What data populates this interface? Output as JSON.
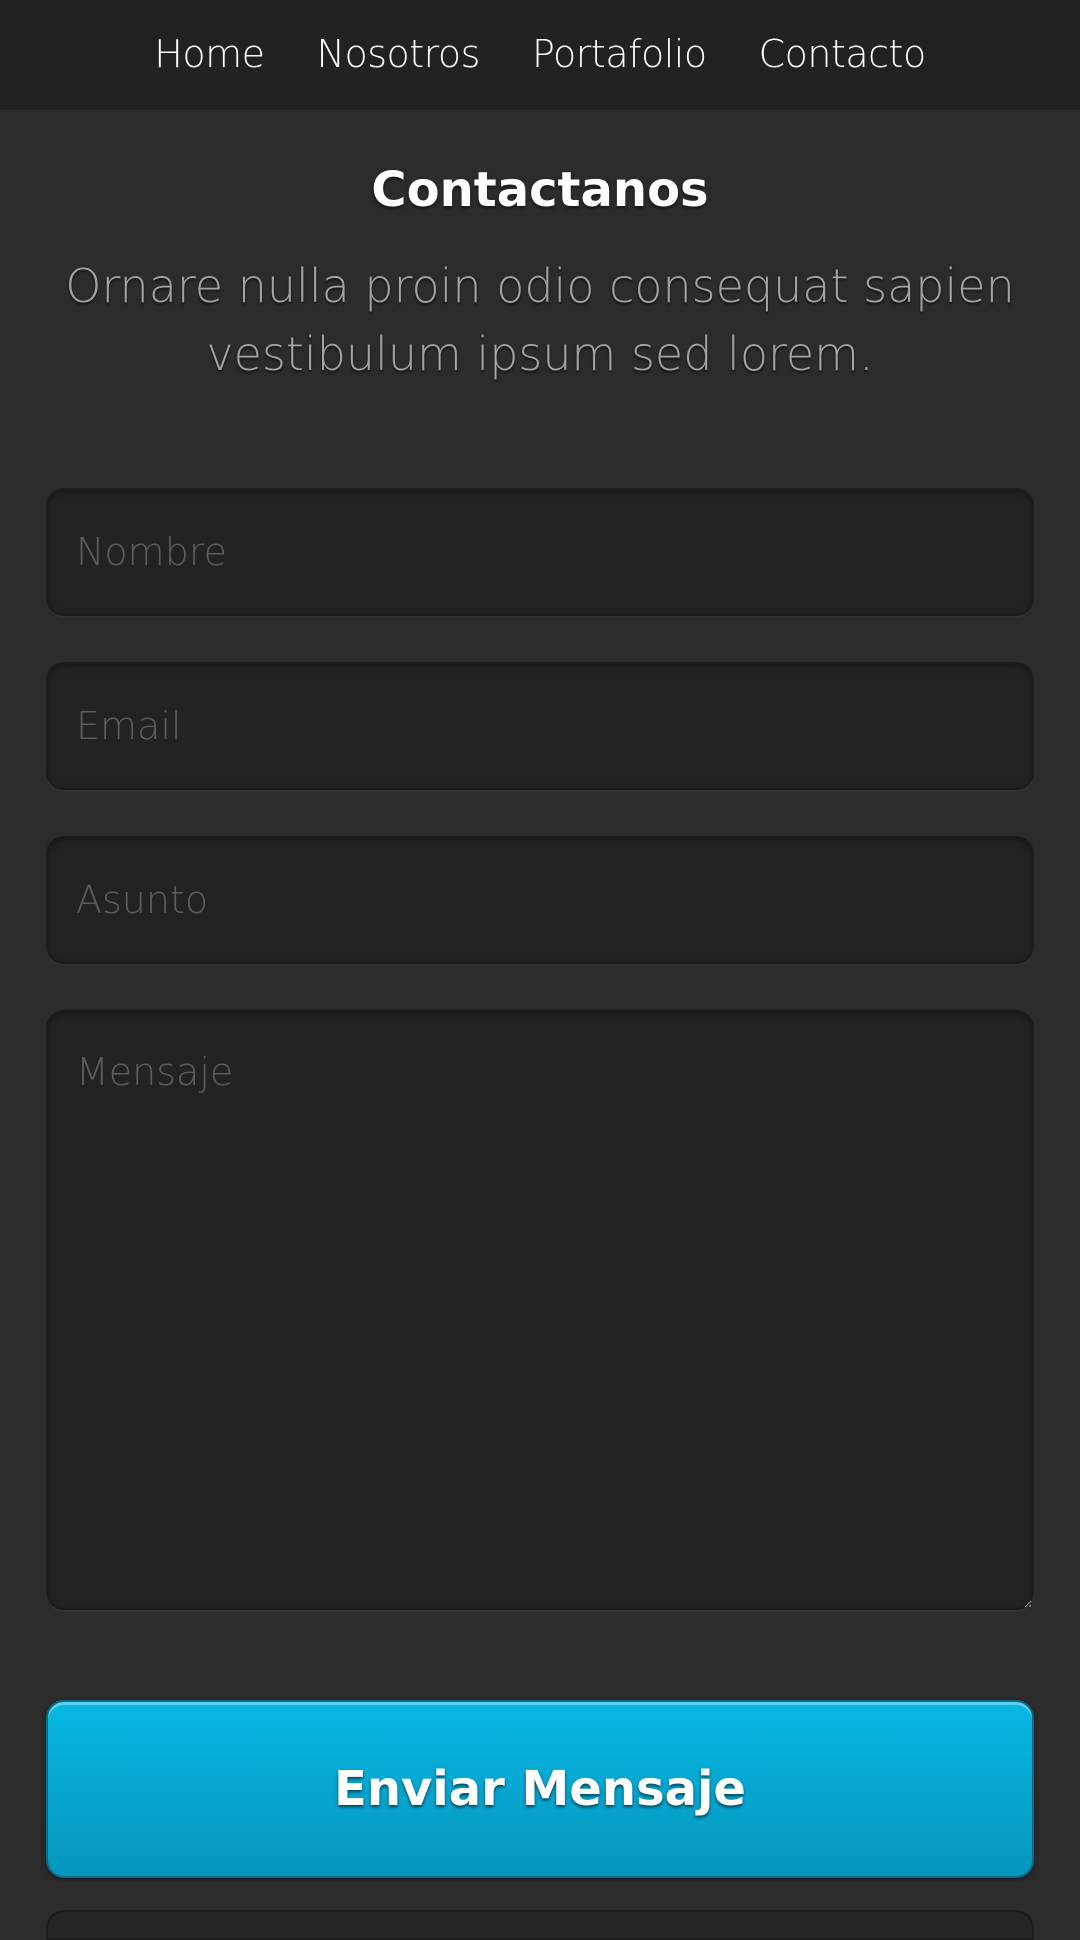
{
  "nav": {
    "items": [
      {
        "label": "Home"
      },
      {
        "label": "Nosotros"
      },
      {
        "label": "Portafolio"
      },
      {
        "label": "Contacto"
      }
    ]
  },
  "contact": {
    "title": "Contactanos",
    "subtitle": "Ornare nulla proin odio consequat sapien vestibulum ipsum sed lorem.",
    "fields": {
      "name_placeholder": "Nombre",
      "email_placeholder": "Email",
      "subject_placeholder": "Asunto",
      "message_placeholder": "Mensaje"
    },
    "submit_label": "Enviar Mensaje"
  },
  "colors": {
    "background": "#2c2c2c",
    "nav_background": "#222222",
    "field_background": "#232323",
    "accent": "#06b8e3"
  }
}
